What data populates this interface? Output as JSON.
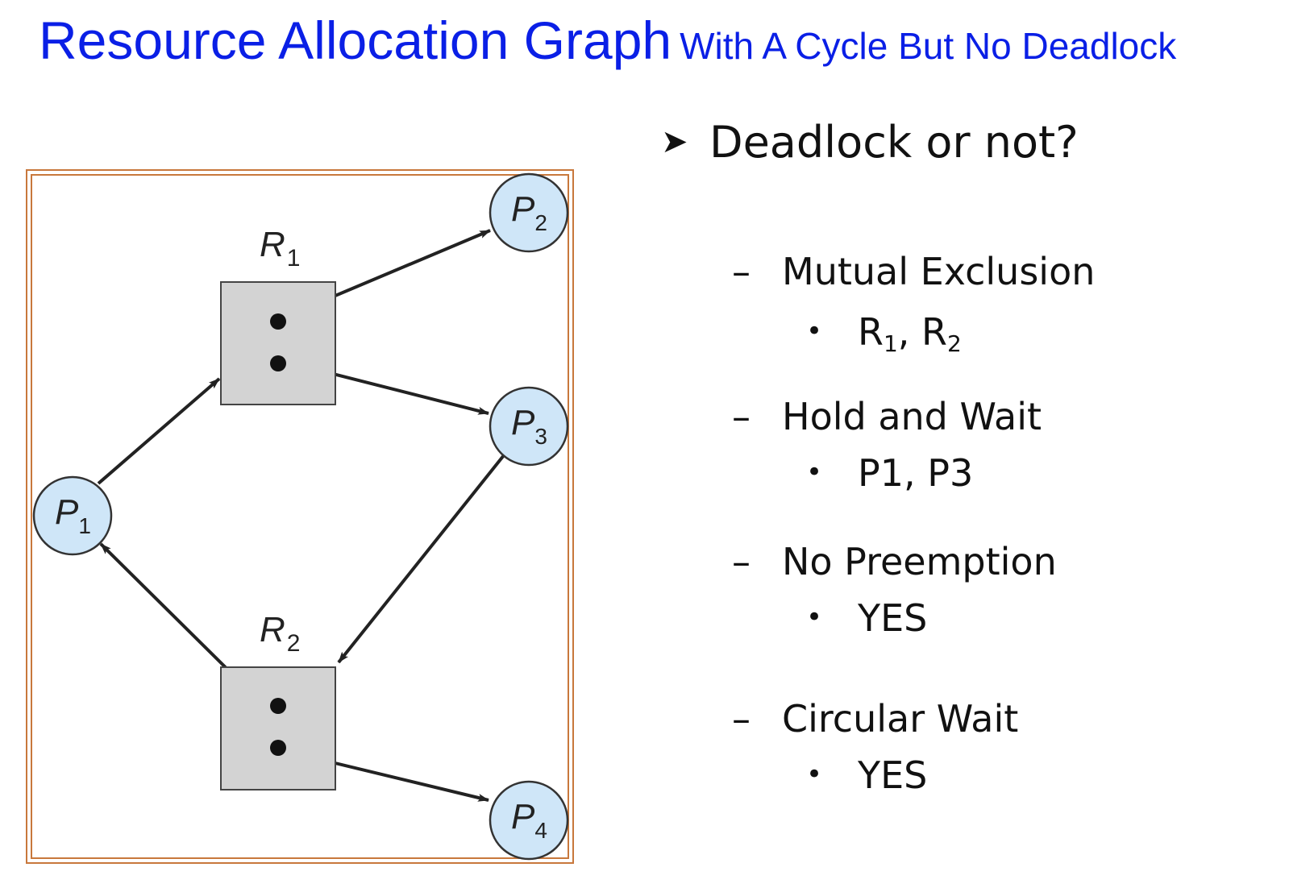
{
  "title": {
    "main": "Resource Allocation Graph",
    "sub": "With A Cycle But No Deadlock",
    "color": "#0a1fe6"
  },
  "graph": {
    "frame_color": "#c8783c",
    "process_fill": "#cfe6f8",
    "resource_fill": "#d3d3d3",
    "processes": [
      {
        "id": "p1",
        "letter": "P",
        "sub": "1"
      },
      {
        "id": "p2",
        "letter": "P",
        "sub": "2"
      },
      {
        "id": "p3",
        "letter": "P",
        "sub": "3"
      },
      {
        "id": "p4",
        "letter": "P",
        "sub": "4"
      }
    ],
    "resources": [
      {
        "id": "r1",
        "letter": "R",
        "sub": "1",
        "instances": 2
      },
      {
        "id": "r2",
        "letter": "R",
        "sub": "2",
        "instances": 2
      }
    ],
    "edges": [
      {
        "from": "p1",
        "to": "r1",
        "kind": "request"
      },
      {
        "from": "r1",
        "to": "p2",
        "kind": "assignment"
      },
      {
        "from": "r1",
        "to": "p3",
        "kind": "assignment"
      },
      {
        "from": "p3",
        "to": "r2",
        "kind": "request"
      },
      {
        "from": "r2",
        "to": "p1",
        "kind": "assignment"
      },
      {
        "from": "r2",
        "to": "p4",
        "kind": "assignment"
      }
    ]
  },
  "panel": {
    "question_marker": "arrow-bullet-icon",
    "question": "Deadlock or not?",
    "dash": "–",
    "bullet": "•",
    "conditions": [
      {
        "label": "Mutual Exclusion",
        "value_parts": [
          "R",
          "1",
          ", R",
          "2"
        ]
      },
      {
        "label": "Hold and Wait",
        "value": "P1, P3"
      },
      {
        "label": "No Preemption",
        "value": "YES"
      },
      {
        "label": "Circular Wait",
        "value": "YES"
      }
    ]
  }
}
